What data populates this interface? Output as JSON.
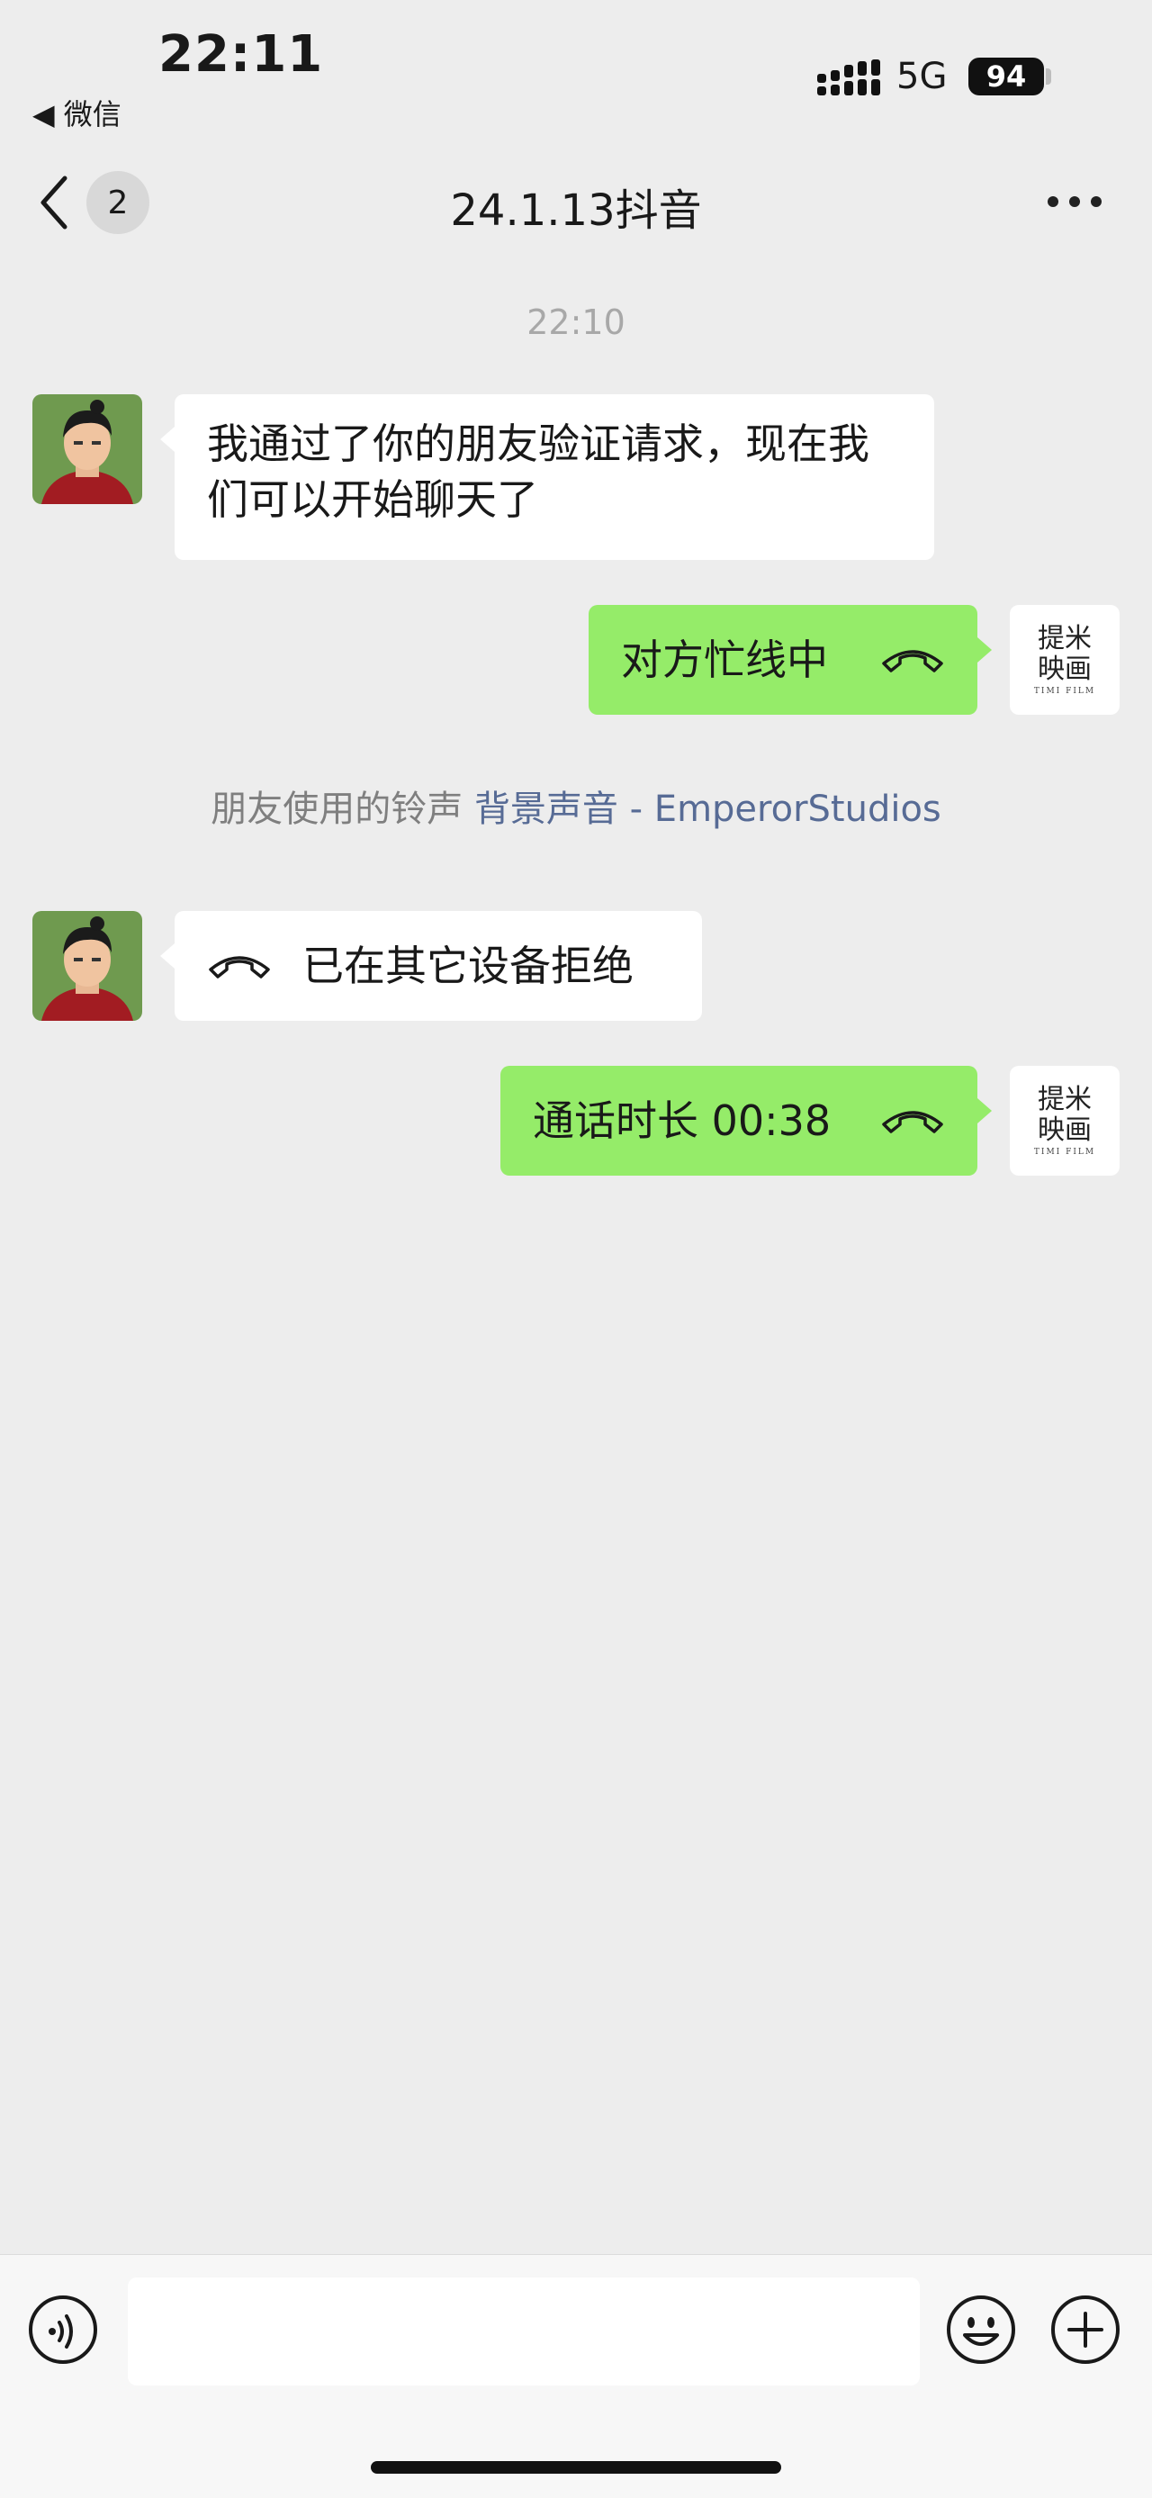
{
  "status_bar": {
    "time": "22:11",
    "back_app_label": "◀ 微信",
    "network": "5G",
    "battery": "94"
  },
  "nav": {
    "unread_count": "2",
    "title": "24.1.13抖音"
  },
  "chat": {
    "timestamp": "22:10",
    "messages": [
      {
        "side": "left",
        "text": "我通过了你的朋友验证请求，现在我们可以开始聊天了"
      },
      {
        "side": "right",
        "text": "对方忙线中"
      },
      {
        "side": "left",
        "text": "已在其它设备拒绝"
      },
      {
        "side": "right",
        "text": "通话时长 00:38"
      }
    ],
    "system_notice": {
      "prefix": "朋友使用的铃声 ",
      "link": "背景声音 - EmperorStudios"
    }
  },
  "self_avatar": {
    "line1": "提米",
    "line2": "映画",
    "line3": "TIMI FILM"
  },
  "icons": {
    "back": "chevron-left-icon",
    "more": "more-dots-icon",
    "voice": "voice-icon",
    "emoji": "emoji-icon",
    "plus": "plus-icon",
    "call": "phone-hangup-icon"
  },
  "colors": {
    "background": "#ededed",
    "bubble_green": "#95ec69",
    "bubble_white": "#ffffff",
    "link": "#576b95"
  }
}
